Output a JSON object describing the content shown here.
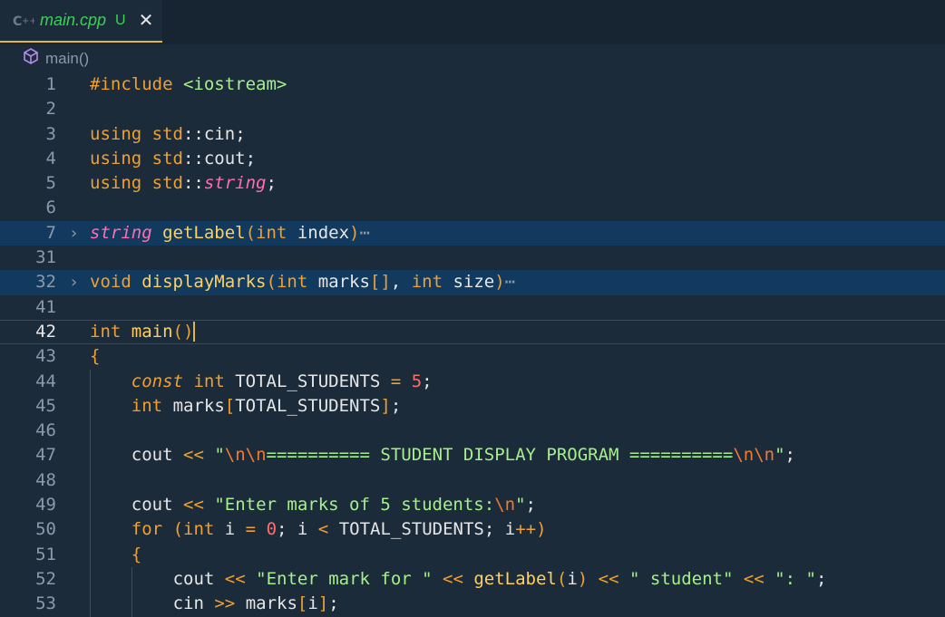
{
  "tab": {
    "filename": "main.cpp",
    "status": "U",
    "close_glyph": "✕",
    "icon": "cpp-file-icon"
  },
  "breadcrumb": {
    "symbol": "main()",
    "icon": "cube-icon"
  },
  "lines": [
    {
      "n": "1",
      "t": [
        [
          "inc",
          "#include "
        ],
        [
          "str",
          "<iostream>"
        ]
      ]
    },
    {
      "n": "2",
      "t": []
    },
    {
      "n": "3",
      "t": [
        [
          "kw",
          "using "
        ],
        [
          "kw",
          "std"
        ],
        [
          "pun",
          "::"
        ],
        [
          "id",
          "cin"
        ],
        [
          "pun",
          ";"
        ]
      ]
    },
    {
      "n": "4",
      "t": [
        [
          "kw",
          "using "
        ],
        [
          "kw",
          "std"
        ],
        [
          "pun",
          "::"
        ],
        [
          "id",
          "cout"
        ],
        [
          "pun",
          ";"
        ]
      ]
    },
    {
      "n": "5",
      "t": [
        [
          "kw",
          "using "
        ],
        [
          "kw",
          "std"
        ],
        [
          "pun",
          "::"
        ],
        [
          "ty",
          "string"
        ],
        [
          "pun",
          ";"
        ]
      ]
    },
    {
      "n": "6",
      "t": []
    },
    {
      "n": "7",
      "fold": true,
      "hl": true,
      "t": [
        [
          "ty",
          "string "
        ],
        [
          "fn",
          "getLabel"
        ],
        [
          "br",
          "("
        ],
        [
          "kw",
          "int "
        ],
        [
          "id",
          "index"
        ],
        [
          "br",
          ")"
        ],
        [
          "dots",
          "⋯"
        ]
      ]
    },
    {
      "n": "31",
      "t": []
    },
    {
      "n": "32",
      "fold": true,
      "hl": true,
      "t": [
        [
          "kw",
          "void "
        ],
        [
          "fn",
          "displayMarks"
        ],
        [
          "br",
          "("
        ],
        [
          "kw",
          "int "
        ],
        [
          "id",
          "marks"
        ],
        [
          "br",
          "[]"
        ],
        [
          "pun",
          ", "
        ],
        [
          "kw",
          "int "
        ],
        [
          "id",
          "size"
        ],
        [
          "br",
          ")"
        ],
        [
          "dots",
          "⋯"
        ]
      ]
    },
    {
      "n": "41",
      "t": []
    },
    {
      "n": "42",
      "cur": true,
      "t": [
        [
          "kw",
          "int "
        ],
        [
          "fn",
          "main"
        ],
        [
          "br",
          "()"
        ]
      ]
    },
    {
      "n": "43",
      "t": [
        [
          "br",
          "{"
        ]
      ]
    },
    {
      "n": "44",
      "ind": 1,
      "t": [
        [
          "cst",
          "const "
        ],
        [
          "kw",
          "int "
        ],
        [
          "id",
          "TOTAL_STUDENTS "
        ],
        [
          "op",
          "= "
        ],
        [
          "num",
          "5"
        ],
        [
          "pun",
          ";"
        ]
      ]
    },
    {
      "n": "45",
      "ind": 1,
      "t": [
        [
          "kw",
          "int "
        ],
        [
          "id",
          "marks"
        ],
        [
          "br",
          "["
        ],
        [
          "id",
          "TOTAL_STUDENTS"
        ],
        [
          "br",
          "]"
        ],
        [
          "pun",
          ";"
        ]
      ]
    },
    {
      "n": "46",
      "ind": 1,
      "t": []
    },
    {
      "n": "47",
      "ind": 1,
      "t": [
        [
          "id",
          "cout "
        ],
        [
          "op",
          "<< "
        ],
        [
          "str",
          "\""
        ],
        [
          "esc",
          "\\n\\n"
        ],
        [
          "str",
          "========== STUDENT DISPLAY PROGRAM =========="
        ],
        [
          "esc",
          "\\n\\n"
        ],
        [
          "str",
          "\""
        ],
        [
          "pun",
          ";"
        ]
      ]
    },
    {
      "n": "48",
      "ind": 1,
      "t": []
    },
    {
      "n": "49",
      "ind": 1,
      "t": [
        [
          "id",
          "cout "
        ],
        [
          "op",
          "<< "
        ],
        [
          "str",
          "\"Enter marks of 5 students:"
        ],
        [
          "esc",
          "\\n"
        ],
        [
          "str",
          "\""
        ],
        [
          "pun",
          ";"
        ]
      ]
    },
    {
      "n": "50",
      "ind": 1,
      "t": [
        [
          "kw",
          "for "
        ],
        [
          "br",
          "("
        ],
        [
          "kw",
          "int "
        ],
        [
          "id",
          "i "
        ],
        [
          "op",
          "= "
        ],
        [
          "num",
          "0"
        ],
        [
          "pun",
          "; "
        ],
        [
          "id",
          "i "
        ],
        [
          "op",
          "< "
        ],
        [
          "id",
          "TOTAL_STUDENTS"
        ],
        [
          "pun",
          "; "
        ],
        [
          "id",
          "i"
        ],
        [
          "op",
          "++"
        ],
        [
          "br",
          ")"
        ]
      ]
    },
    {
      "n": "51",
      "ind": 1,
      "t": [
        [
          "br",
          "{"
        ]
      ]
    },
    {
      "n": "52",
      "ind": 2,
      "t": [
        [
          "id",
          "cout "
        ],
        [
          "op",
          "<< "
        ],
        [
          "str",
          "\"Enter mark for \" "
        ],
        [
          "op",
          "<< "
        ],
        [
          "fn",
          "getLabel"
        ],
        [
          "br",
          "("
        ],
        [
          "id",
          "i"
        ],
        [
          "br",
          ")"
        ],
        [
          "op",
          " << "
        ],
        [
          "str",
          "\" student\" "
        ],
        [
          "op",
          "<< "
        ],
        [
          "str",
          "\": \""
        ],
        [
          "pun",
          ";"
        ]
      ]
    },
    {
      "n": "53",
      "ind": 2,
      "t": [
        [
          "id",
          "cin "
        ],
        [
          "op",
          ">> "
        ],
        [
          "id",
          "marks"
        ],
        [
          "br",
          "["
        ],
        [
          "id",
          "i"
        ],
        [
          "br",
          "]"
        ],
        [
          "pun",
          ";"
        ]
      ]
    }
  ]
}
